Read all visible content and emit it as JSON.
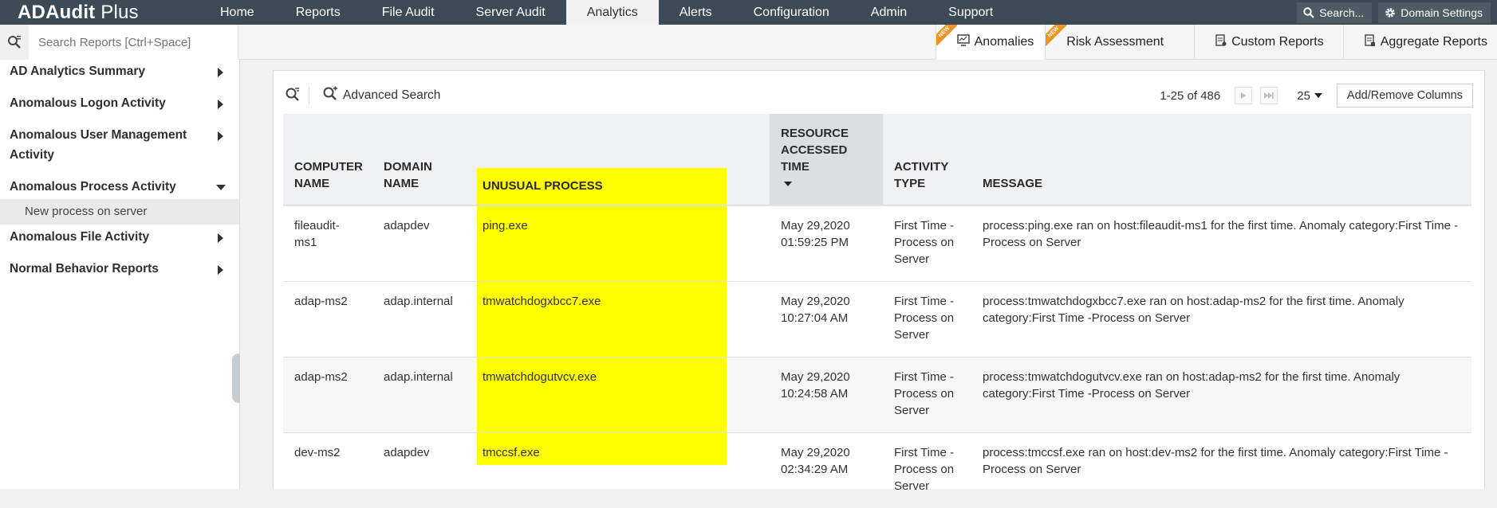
{
  "app": {
    "brand_bold": "ADAudit",
    "brand_rest": " Plus"
  },
  "nav": [
    {
      "label": "Home"
    },
    {
      "label": "Reports"
    },
    {
      "label": "File Audit"
    },
    {
      "label": "Server Audit"
    },
    {
      "label": "Analytics",
      "active": true
    },
    {
      "label": "Alerts"
    },
    {
      "label": "Configuration"
    },
    {
      "label": "Admin"
    },
    {
      "label": "Support"
    }
  ],
  "top_right": {
    "search": "Search...",
    "domain_settings": "Domain Settings"
  },
  "search": {
    "placeholder": "Search Reports [Ctrl+Space]"
  },
  "tabs": [
    {
      "label": "Anomalies",
      "new": "NEW",
      "icon": "monitor-icon",
      "active": true
    },
    {
      "label": "Risk Assessment",
      "new": "NEW"
    },
    {
      "label": "Custom Reports",
      "icon": "custom-report-icon"
    },
    {
      "label": "Aggregate Reports",
      "icon": "aggregate-report-icon"
    }
  ],
  "sidebar": {
    "items": [
      {
        "label": "AD Analytics Summary"
      },
      {
        "label": "Anomalous Logon Activity"
      },
      {
        "label": "Anomalous User Management Activity"
      },
      {
        "label": "Anomalous Process Activity",
        "expanded": true
      },
      {
        "label": "Anomalous File Activity"
      },
      {
        "label": "Normal Behavior Reports"
      }
    ],
    "sub_item": "New process on server"
  },
  "toolbar": {
    "advanced_search": "Advanced Search",
    "count": "1-25 of 486",
    "page_size": "25",
    "add_remove_columns": "Add/Remove Columns"
  },
  "table": {
    "columns": [
      "COMPUTER NAME",
      "DOMAIN NAME",
      "UNUSUAL PROCESS",
      "RESOURCE ACCESSED TIME",
      "ACTIVITY TYPE",
      "MESSAGE"
    ],
    "rows": [
      [
        "fileaudit-ms1",
        "adapdev",
        "ping.exe",
        "May 29,2020 01:59:25 PM",
        "First Time - Process on Server",
        "process:ping.exe ran on host:fileaudit-ms1 for the first time. Anomaly category:First Time -Process on Server"
      ],
      [
        "adap-ms2",
        "adap.internal",
        "tmwatchdogxbcc7.exe",
        "May 29,2020 10:27:04 AM",
        "First Time - Process on Server",
        "process:tmwatchdogxbcc7.exe ran on host:adap-ms2 for the first time. Anomaly category:First Time -Process on Server"
      ],
      [
        "adap-ms2",
        "adap.internal",
        "tmwatchdogutvcv.exe",
        "May 29,2020 10:24:58 AM",
        "First Time - Process on Server",
        "process:tmwatchdogutvcv.exe ran on host:adap-ms2 for the first time. Anomaly category:First Time -Process on Server"
      ],
      [
        "dev-ms2",
        "adapdev",
        "tmccsf.exe",
        "May 29,2020 02:34:29 AM",
        "First Time - Process on Server",
        "process:tmccsf.exe ran on host:dev-ms2 for the first time. Anomaly category:First Time -Process on Server"
      ]
    ]
  },
  "colors": {
    "topbar": "#3b4a54",
    "highlight": "#ffff00",
    "new_badge": "#f39221"
  }
}
